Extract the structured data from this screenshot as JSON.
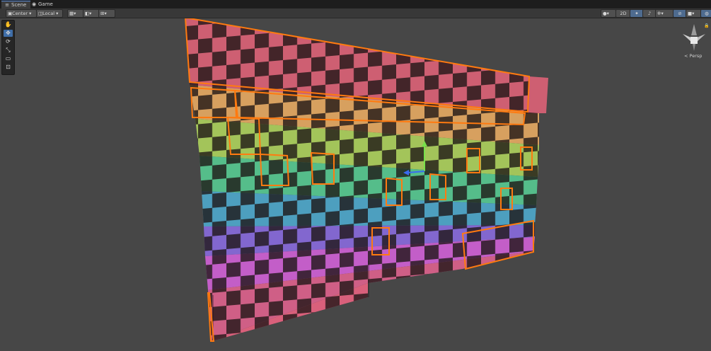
{
  "tabs": [
    {
      "label": "Scene",
      "icon": "scene-icon",
      "active": true
    },
    {
      "label": "Game",
      "icon": "game-icon",
      "active": false
    }
  ],
  "toolbar": {
    "pivot_label": "Center",
    "space_label": "Local",
    "mode_2d_label": "2D"
  },
  "tools": [
    "hand-tool-icon",
    "move-tool-icon",
    "rotate-tool-icon",
    "scale-tool-icon",
    "rect-tool-icon",
    "transform-tool-icon"
  ],
  "gizmo": {
    "projection_label": "Persp"
  },
  "strip_colors": [
    "#ce5f72",
    "#d7a05f",
    "#a3c45a",
    "#55bd8a",
    "#4d9fbf",
    "#8267cf",
    "#c35ec8",
    "#cf5f86",
    "#d9607b"
  ],
  "selection_color": "#ff7a10",
  "checker_dark": "#2a1d1d"
}
